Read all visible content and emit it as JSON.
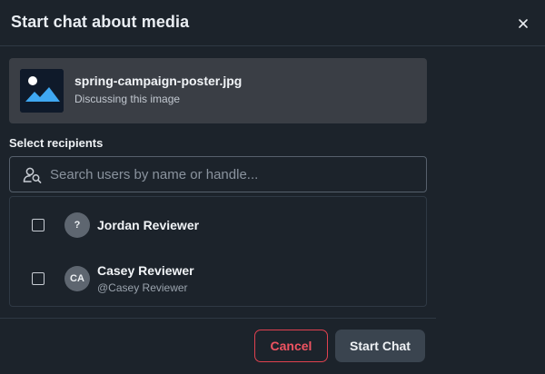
{
  "modal": {
    "title": "Start chat about media",
    "close_label": "×"
  },
  "media": {
    "file_name": "spring-campaign-poster.jpg",
    "subtitle": "Discussing this image",
    "icon": "image-thumbnail-icon"
  },
  "recipients": {
    "label": "Select recipients",
    "search_placeholder": "Search users by name or handle...",
    "users": [
      {
        "avatar_text": "?",
        "name": "Jordan Reviewer",
        "handle": "",
        "checked": false
      },
      {
        "avatar_text": "CA",
        "name": "Casey Reviewer",
        "handle": "@Casey Reviewer",
        "checked": false
      }
    ]
  },
  "footer": {
    "cancel_label": "Cancel",
    "start_label": "Start Chat"
  },
  "colors": {
    "background": "#1c232b",
    "cancel_accent": "#e0414f",
    "primary_button": "#3a444f",
    "media_card": "#3a3e45"
  }
}
